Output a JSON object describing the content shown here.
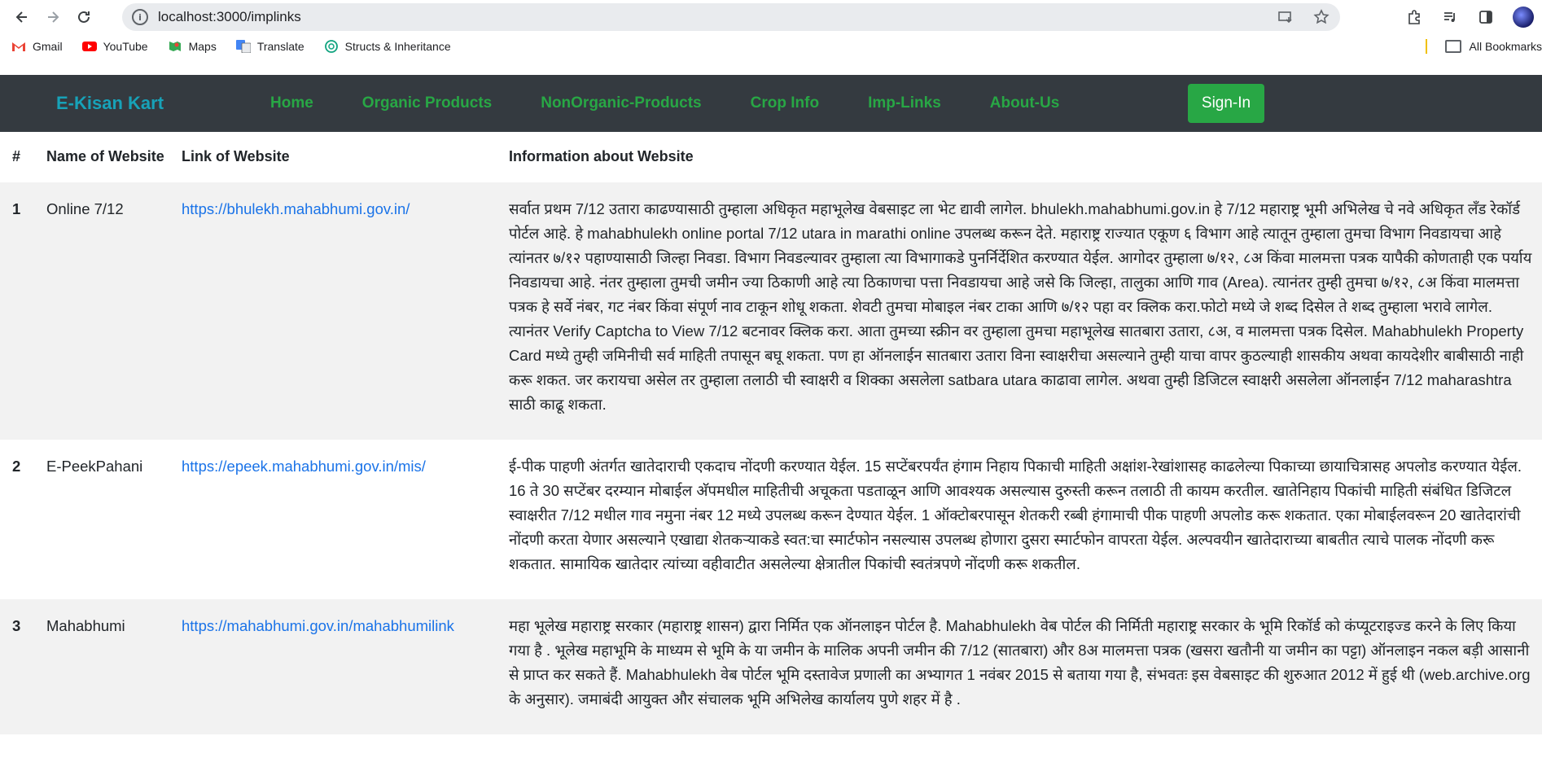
{
  "browser": {
    "url": "localhost:3000/implinks",
    "bookmarks": [
      "Gmail",
      "YouTube",
      "Maps",
      "Translate",
      "Structs & Inheritance"
    ],
    "all_bookmarks": "All Bookmarks"
  },
  "site": {
    "brand": "E-Kisan Kart",
    "nav": [
      "Home",
      "Organic Products",
      "NonOrganic-Products",
      "Crop Info",
      "Imp-Links",
      "About-Us"
    ],
    "signin": "Sign-In"
  },
  "table": {
    "headers": [
      "#",
      "Name of Website",
      "Link of Website",
      "Information about Website"
    ],
    "rows": [
      {
        "num": "1",
        "name": "Online 7/12",
        "link": "https://bhulekh.mahabhumi.gov.in/",
        "info": "सर्वात प्रथम 7/12 उतारा काढण्यासाठी तुम्हाला अधिकृत महाभूलेख वेबसाइट ला भेट द्यावी लागेल. bhulekh.mahabhumi.gov.in हे 7/12 महाराष्ट्र भूमी अभिलेख चे नवे अधिकृत लँड रेकॉर्ड पोर्टल आहे. हे mahabhulekh online portal 7/12 utara in marathi online उपलब्ध करून देते. महाराष्ट्र राज्यात एकूण ६ विभाग आहे त्यातून तुम्हाला तुमचा विभाग निवडायचा आहे त्यांनतर ७/१२ पहाण्यासाठी जिल्हा निवडा. विभाग निवडल्यावर तुम्हाला त्या विभागाकडे पुनर्निर्देशित करण्यात येईल. आगोदर तुम्हाला ७/१२, ८अ किंवा मालमत्ता पत्रक यापैकी कोणताही एक पर्याय निवडायचा आहे. नंतर तुम्हाला तुमची जमीन ज्या ठिकाणी आहे त्या ठिकाणचा पत्ता निवडायचा आहे जसे कि जिल्हा, तालुका आणि गाव (Area). त्यानंतर तुम्ही तुमचा ७/१२, ८अ किंवा मालमत्ता पत्रक हे सर्वे नंबर, गट नंबर किंवा संपूर्ण नाव टाकून शोधू शकता. शेवटी तुमचा मोबाइल नंबर टाका आणि ७/१२ पहा वर क्लिक करा.फोटो मध्ये जे शब्द दिसेल ते शब्द तुम्हाला भरावे लागेल. त्यानंतर Verify Captcha to View 7/12 बटनावर क्लिक करा. आता तुमच्या स्क्रीन वर तुम्हाला तुमचा महाभूलेख सातबारा उतारा, ८अ, व मालमत्ता पत्रक दिसेल. Mahabhulekh Property Card मध्ये तुम्ही जमिनीची सर्व माहिती तपासून बघू शकता. पण हा ऑनलाईन सातबारा उतारा विना स्वाक्षरीचा असल्याने तुम्ही याचा वापर कुठल्याही शासकीय अथवा कायदेशीर बाबीसाठी नाही करू शकत. जर करायचा असेल तर तुम्हाला तलाठी ची स्वाक्षरी व शिक्का असलेला satbara utara काढावा लागेल. अथवा तुम्ही डिजिटल स्वाक्षरी असलेला ऑनलाईन 7/12 maharashtra साठी काढू शकता."
      },
      {
        "num": "2",
        "name": "E-PeekPahani",
        "link": "https://epeek.mahabhumi.gov.in/mis/",
        "info": "ई-पीक पाहणी अंतर्गत खातेदाराची एकदाच नोंदणी करण्यात येईल. 15 सप्टेंबरपर्यंत हंगाम निहाय पिकाची माहिती अक्षांश-रेखांशासह काढलेल्या पिकाच्या छायाचित्रासह अपलोड करण्यात येईल. 16 ते 30 सप्टेंबर दरम्यान मोबाईल अ‍ॅपमधील माहितीची अचूकता पडताळून आणि आवश्यक असल्यास दुरुस्ती करून तलाठी ती कायम करतील. खातेनिहाय पिकांची माहिती संबंधित डिजिटल स्वाक्षरीत 7/12 मधील गाव नमुना नंबर 12 मध्ये उपलब्ध करून देण्यात येईल. 1 ऑक्टोबरपासून शेतकरी रब्बी हंगामाची पीक पाहणी अपलोड करू शकतात. एका मोबाईलवरून 20 खातेदारांची नोंदणी करता येणार असल्याने एखाद्या शेतकऱ्याकडे स्वत:चा स्मार्टफोन नसल्यास उपलब्ध होणारा दुसरा स्मार्टफोन वापरता येईल. अल्पवयीन खातेदाराच्या बाबतीत त्याचे पालक नोंदणी करू शकतात. सामायिक खातेदार त्यांच्या वहीवाटीत असलेल्या क्षेत्रातील पिकांची स्वतंत्रपणे नोंदणी करू शकतील."
      },
      {
        "num": "3",
        "name": "Mahabhumi",
        "link": "https://mahabhumi.gov.in/mahabhumilink",
        "info": "महा भूलेख महाराष्ट्र सरकार (महाराष्ट्र शासन) द्वारा निर्मित एक ऑनलाइन पोर्टल है. Mahabhulekh वेब पोर्टल की निर्मिती महाराष्ट्र सरकार के भूमि रिकॉर्ड को कंप्यूटराइज्ड करने के लिए किया गया है . भूलेख महाभूमि के माध्यम से भूमि के या जमीन के मालिक अपनी जमीन की 7/12 (सातबारा) और 8अ मालमत्ता पत्रक (खसरा खतौनी या जमीन का पट्टा) ऑनलाइन नकल बड़ी आसानी से प्राप्त कर सकते हैं. Mahabhulekh वेब पोर्टल भूमि दस्तावेज प्रणाली का अभ्यागत 1 नवंबर 2015 से बताया गया है, संभवतः इस वेबसाइट की शुरुआत 2012 में हुई थी (web.archive.org के अनुसार). जमाबंदी आयुक्त और संचालक भूमि अभिलेख कार्यालय पुणे शहर में है ."
      }
    ]
  }
}
